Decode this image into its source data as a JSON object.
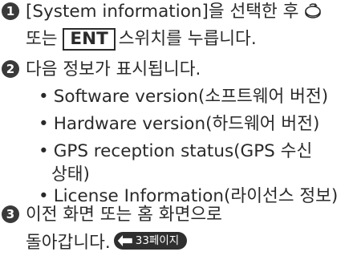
{
  "steps": [
    {
      "number": "1",
      "line1_text": "[System information]을 선택한 후",
      "icon": "rotary-dial-icon",
      "line2_prefix": "또는",
      "key_label": "ENT",
      "line2_suffix": "스위치를 누릅니다."
    },
    {
      "number": "2",
      "text": "다음 정보가 표시됩니다.",
      "bullets": [
        "Software version(소프트웨어 버전)",
        "Hardware version(하드웨어 버전)",
        "GPS reception status(GPS 수신",
        "상태)",
        "License Information(라이선스 정보)"
      ]
    },
    {
      "number": "3",
      "line1_text": "이전 화면 또는 홈 화면으로",
      "line2_text": "돌아갑니다.",
      "page_ref_label": "33페이지"
    }
  ],
  "bullet_char": "•",
  "colors": {
    "text": "#2a2a2a",
    "badge": "#3a3a3a",
    "page_ref_bg": "#2f2f2f"
  }
}
